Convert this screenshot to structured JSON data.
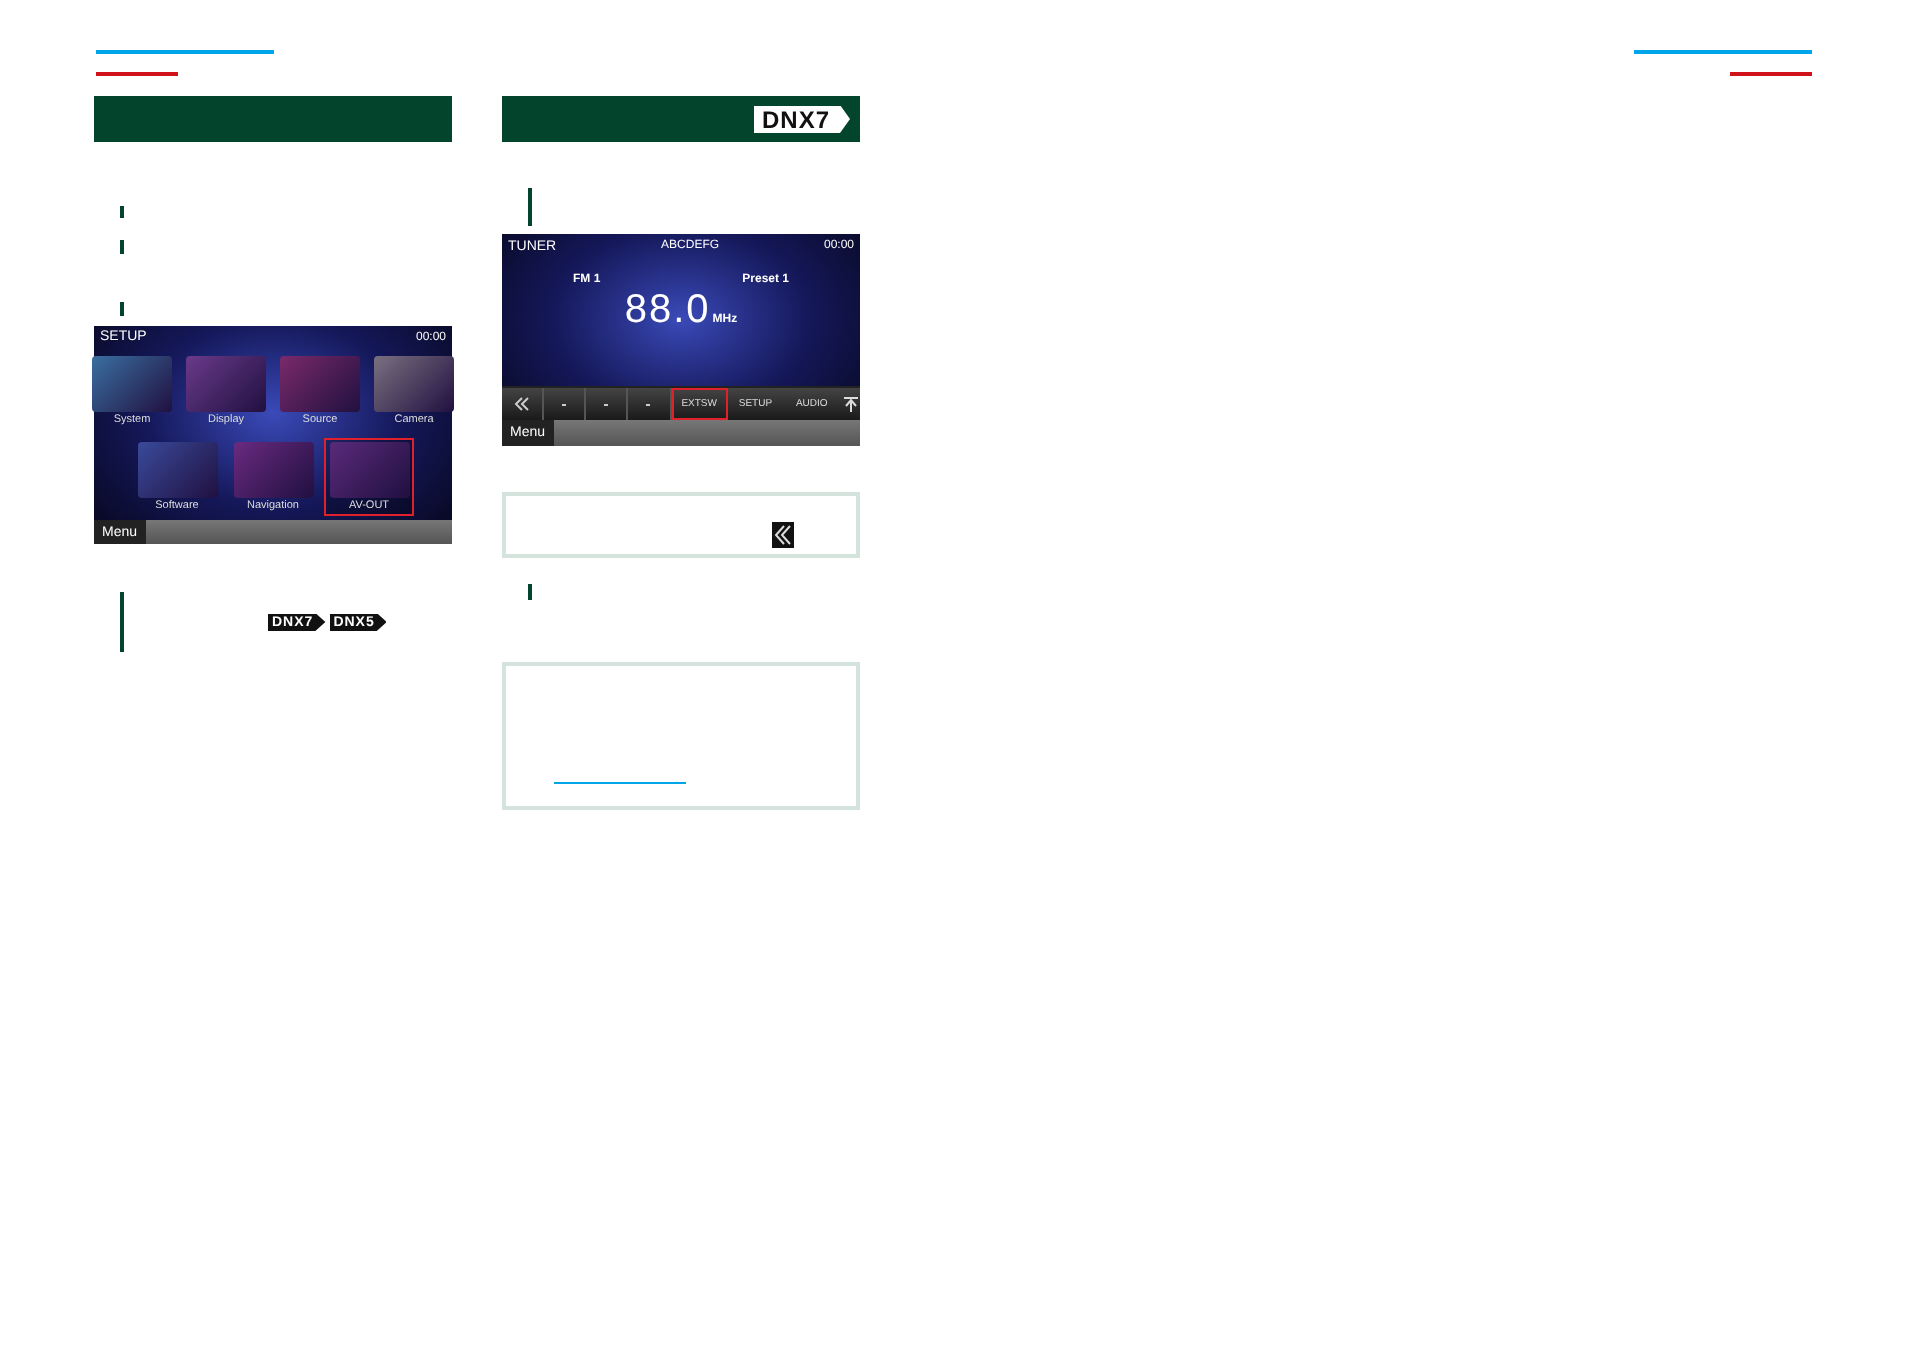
{
  "left": {
    "setup_screen": {
      "title": "SETUP",
      "time": "00:00",
      "tiles": [
        {
          "label": "System",
          "selected": false
        },
        {
          "label": "Display",
          "selected": false
        },
        {
          "label": "Source",
          "selected": false
        },
        {
          "label": "Camera",
          "selected": false
        },
        {
          "label": "Software",
          "selected": false
        },
        {
          "label": "Navigation",
          "selected": false
        },
        {
          "label": "AV-OUT",
          "selected": true
        }
      ],
      "menu": "Menu"
    },
    "model_badges": [
      "DNX7",
      "DNX5"
    ]
  },
  "right": {
    "header_badge": "DNX7",
    "tuner_screen": {
      "title": "TUNER",
      "station": "ABCDEFG",
      "time": "00:00",
      "band": "FM 1",
      "preset": "Preset 1",
      "frequency": "88.0",
      "unit": "MHz",
      "buttons": [
        {
          "label": "EXTSW",
          "selected": true
        },
        {
          "label": "SETUP",
          "selected": false
        },
        {
          "label": "AUDIO",
          "selected": false
        }
      ],
      "menu": "Menu"
    }
  }
}
